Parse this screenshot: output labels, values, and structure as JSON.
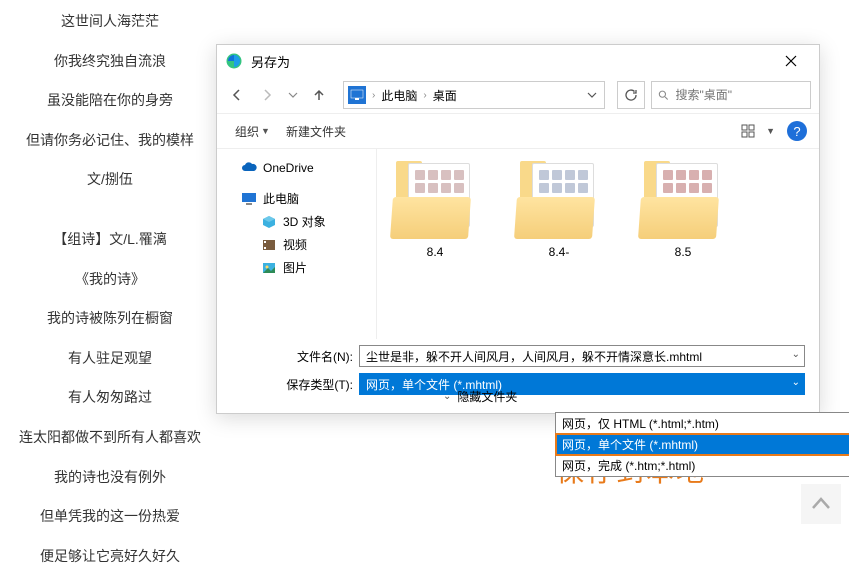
{
  "bg_lines": [
    "这世间人海茫茫",
    "你我终究独自流浪",
    "虽没能陪在你的身旁",
    "但请你务必记住、我的模样",
    "文/捌伍",
    "【组诗】文/L.罹漓",
    "《我的诗》",
    "我的诗被陈列在橱窗",
    "有人驻足观望",
    "有人匆匆路过",
    "连太阳都做不到所有人都喜欢",
    "我的诗也没有例外",
    "但单凭我的这一份热爱",
    "便足够让它亮好久好久"
  ],
  "dialog": {
    "title": "另存为",
    "breadcrumb": {
      "seg1": "此电脑",
      "seg2": "桌面"
    },
    "search_placeholder": "搜索\"桌面\"",
    "toolbar": {
      "organize": "组织",
      "new_folder": "新建文件夹"
    },
    "tree": {
      "onedrive": "OneDrive",
      "this_pc": "此电脑",
      "objects_3d": "3D 对象",
      "videos": "视频",
      "pictures": "图片"
    },
    "files": {
      "f1": "8.4",
      "f2": "8.4-",
      "f3": "8.5"
    },
    "fields": {
      "filename_label": "文件名(N):",
      "filename_value": "尘世是非，躲不开人间风月，人间风月，躲不开情深意长.mhtml",
      "savetype_label": "保存类型(T):",
      "savetype_value": "网页，单个文件 (*.mhtml)"
    },
    "dropdown": {
      "opt1": "网页，仅 HTML (*.html;*.htm)",
      "opt2": "网页，单个文件 (*.mhtml)",
      "opt3": "网页，完成 (*.htm;*.html)"
    },
    "hide_folders": "隐藏文件夹",
    "help": "?"
  },
  "annotation": "保存到本地"
}
